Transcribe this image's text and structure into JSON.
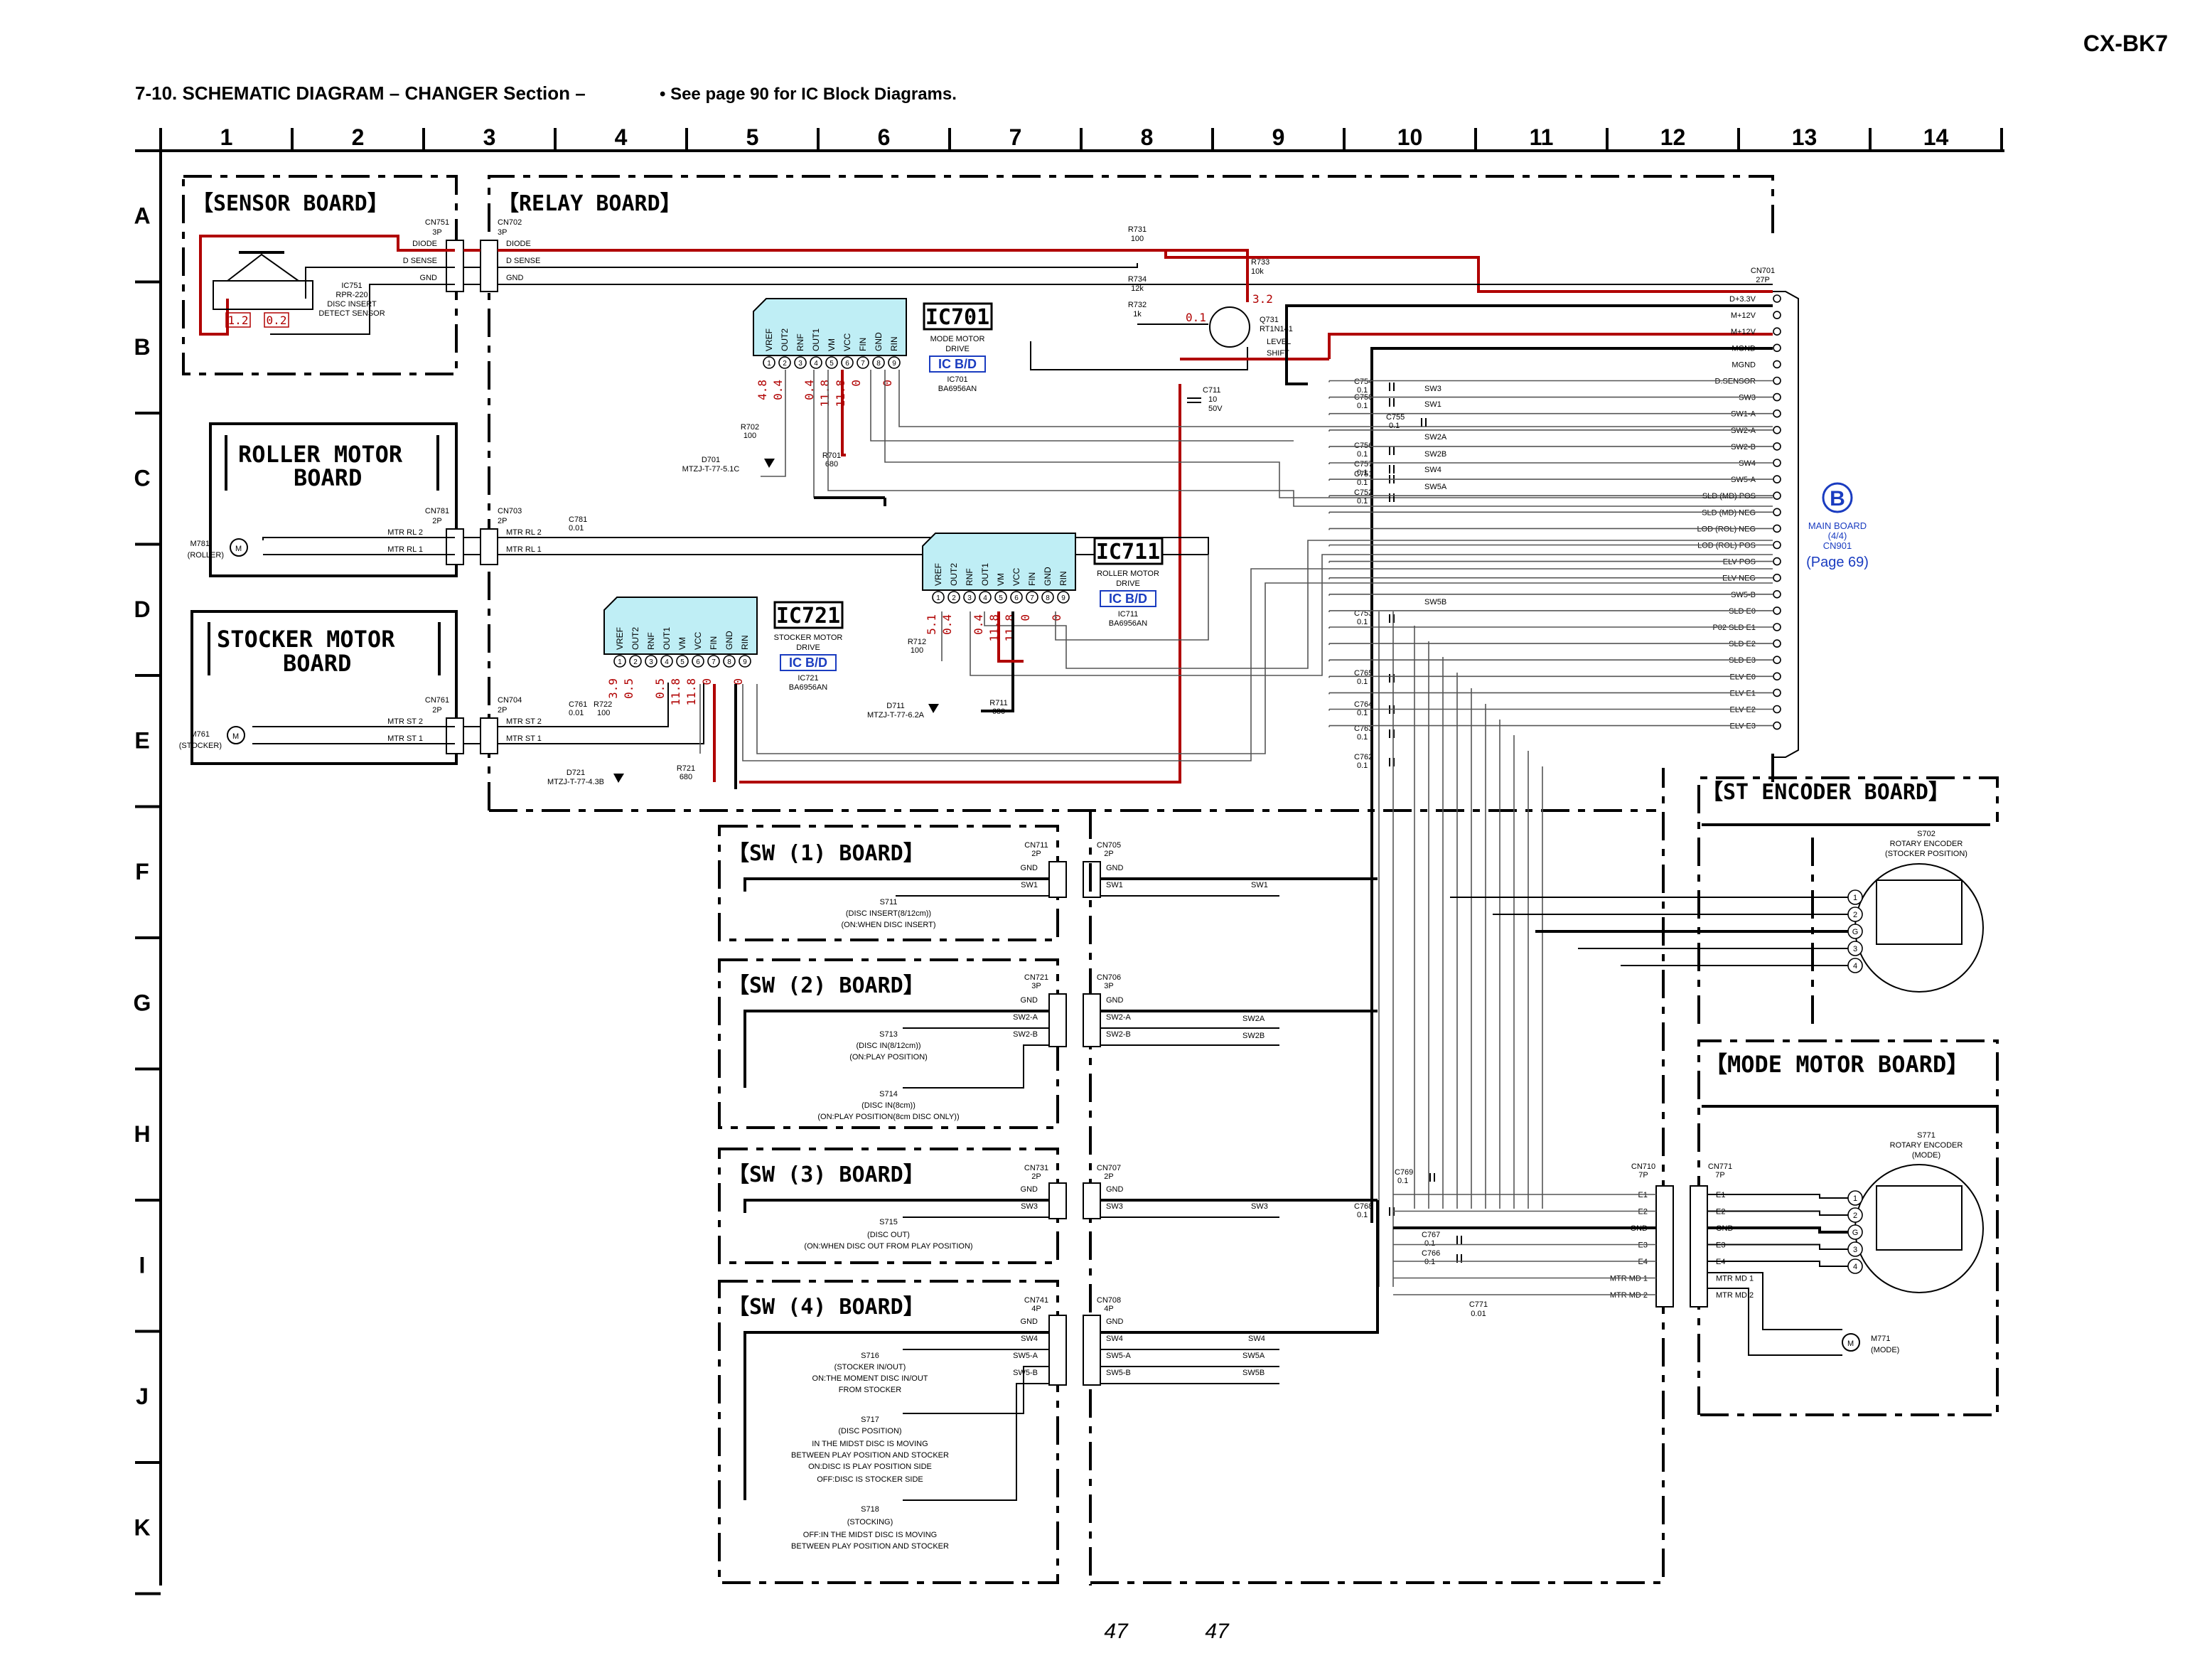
{
  "model": "CX-BK7",
  "title": "7-10.  SCHEMATIC  DIAGRAM  – CHANGER Section –",
  "note": "• See page 90 for IC Block Diagrams.",
  "page_numbers": [
    "47",
    "47"
  ],
  "columns": [
    "1",
    "2",
    "3",
    "4",
    "5",
    "6",
    "7",
    "8",
    "9",
    "10",
    "11",
    "12",
    "13",
    "14"
  ],
  "rows": [
    "A",
    "B",
    "C",
    "D",
    "E",
    "F",
    "G",
    "H",
    "I",
    "J",
    "K"
  ],
  "boards": {
    "sensor": "【SENSOR BOARD】",
    "relay": "【RELAY BOARD】",
    "roller_motor_1": "ROLLER MOTOR",
    "roller_motor_2": "BOARD",
    "stocker_motor_1": "STOCKER MOTOR",
    "stocker_motor_2": "BOARD",
    "sw1": "【SW (1) BOARD】",
    "sw2": "【SW (2) BOARD】",
    "sw3": "【SW (3) BOARD】",
    "sw4": "【SW (4) BOARD】",
    "st_encoder": "【ST ENCODER BOARD】",
    "mode_motor": "【MODE MOTOR BOARD】"
  },
  "sensor": {
    "cn751": [
      "CN751",
      "3P"
    ],
    "pins": [
      "DIODE",
      "D SENSE",
      "GND"
    ],
    "ic751": [
      "IC751",
      "RPR-220",
      "DISC INSERT",
      "DETECT SENSOR"
    ],
    "v1": "1.2",
    "v2": "0.2"
  },
  "relay": {
    "cn702": [
      "CN702",
      "3P"
    ],
    "cn702_pins": [
      "DIODE",
      "D SENSE",
      "GND"
    ],
    "r731": [
      "R731",
      "100"
    ],
    "r733": [
      "R733",
      "10k"
    ],
    "r734": [
      "R734",
      "12k"
    ],
    "r732": [
      "R732",
      "1k"
    ],
    "q731": [
      "Q731",
      "RT1N141",
      "LEVEL",
      "SHIFT"
    ],
    "q_v1": "0.1",
    "q_v2": "3.2",
    "c711": [
      "C711",
      "10",
      "50V"
    ],
    "cn781": [
      "CN781",
      "2P"
    ],
    "cn703": [
      "CN703",
      "2P"
    ],
    "c781": [
      "C781",
      "0.01"
    ],
    "roller_pins": [
      "MTR RL 2",
      "MTR RL 1"
    ],
    "m781": [
      "M781",
      "(ROLLER)"
    ],
    "cn761": [
      "CN761",
      "2P"
    ],
    "cn704": [
      "CN704",
      "2P"
    ],
    "c761": [
      "C761",
      "0.01"
    ],
    "r722": [
      "R722",
      "100"
    ],
    "stocker_pins": [
      "MTR ST 2",
      "MTR ST 1"
    ],
    "m761": [
      "M761",
      "(STOCKER)"
    ],
    "r702": [
      "R702",
      "100"
    ],
    "d701": [
      "D701",
      "MTZJ-T-77-5.1C"
    ],
    "r701": [
      "R701",
      "680"
    ],
    "r712": [
      "R712",
      "100"
    ],
    "d711": [
      "D711",
      "MTZJ-T-77-6.2A"
    ],
    "r711": [
      "R711",
      "680"
    ],
    "r721": [
      "R721",
      "680"
    ],
    "d721": [
      "D721",
      "MTZJ-T-77-4.3B"
    ]
  },
  "ics": [
    {
      "key": "ic701",
      "name": "IC701",
      "desc": [
        "MODE MOTOR",
        "DRIVE"
      ],
      "bd": "IC B/D",
      "part": [
        "IC701",
        "BA6956AN"
      ],
      "pins": [
        "VREF",
        "OUT2",
        "RNF",
        "OUT1",
        "VM",
        "VCC",
        "FIN",
        "GND",
        "RIN"
      ],
      "volts": [
        "4.8",
        "0.4",
        "",
        "0.4",
        "11.8",
        "11.8",
        "0",
        "",
        "0"
      ]
    },
    {
      "key": "ic711",
      "name": "IC711",
      "desc": [
        "ROLLER MOTOR",
        "DRIVE"
      ],
      "bd": "IC B/D",
      "part": [
        "IC711",
        "BA6956AN"
      ],
      "pins": [
        "VREF",
        "OUT2",
        "RNF",
        "OUT1",
        "VM",
        "VCC",
        "FIN",
        "GND",
        "RIN"
      ],
      "volts": [
        "5.1",
        "0.4",
        "",
        "0.4",
        "11.8",
        "11.8",
        "0",
        "",
        "0"
      ]
    },
    {
      "key": "ic721",
      "name": "IC721",
      "desc": [
        "STOCKER MOTOR",
        "DRIVE"
      ],
      "bd": "IC B/D",
      "part": [
        "IC721",
        "BA6956AN"
      ],
      "pins": [
        "VREF",
        "OUT2",
        "RNF",
        "OUT1",
        "VM",
        "VCC",
        "FIN",
        "GND",
        "RIN"
      ],
      "volts": [
        "3.9",
        "0.5",
        "",
        "0.5",
        "11.8",
        "11.8",
        "0",
        "",
        "0"
      ]
    }
  ],
  "caps": [
    [
      "C754",
      "0.1"
    ],
    [
      "C758",
      "0.1"
    ],
    [
      "C755",
      "0.1"
    ],
    [
      "C756",
      "0.1"
    ],
    [
      "C757",
      "0.1"
    ],
    [
      "C751",
      "0.1"
    ],
    [
      "C752",
      "0.1"
    ],
    [
      "C753",
      "0.1"
    ],
    [
      "C765",
      "0.1"
    ],
    [
      "C764",
      "0.1"
    ],
    [
      "C763",
      "0.1"
    ],
    [
      "C762",
      "0.1"
    ],
    [
      "C769",
      "0.1"
    ],
    [
      "C768",
      "0.1"
    ],
    [
      "C767",
      "0.1"
    ],
    [
      "C766",
      "0.1"
    ],
    [
      "C771",
      "0.01"
    ]
  ],
  "sw_labels": [
    "SW3",
    "SW1",
    "SW2A",
    "SW2B",
    "SW4",
    "SW5A",
    "SW5B"
  ],
  "cn701": {
    "label": [
      "CN701",
      "27P"
    ],
    "pins": [
      "D+3.3V",
      "M+12V",
      "M+12V",
      "MGND",
      "MGND",
      "D.SENSOR",
      "SW3",
      "SW1-A",
      "SW2-A",
      "SW2-B",
      "SW4",
      "SW5-A",
      "SLD (MD) POS",
      "SLD (MD) NEG",
      "LOD (ROL) NEG",
      "LOD (ROL) POS",
      "ELV POS",
      "ELV NEG",
      "SW5-B",
      "SLD E0",
      "P02 SLD E1",
      "SLD E2",
      "SLD E3",
      "ELV E0",
      "ELV E1",
      "ELV E2",
      "ELV E3"
    ]
  },
  "main_ref": {
    "letter": "B",
    "lines": [
      "MAIN BOARD",
      "(4/4)",
      "CN901"
    ],
    "page": "(Page 69)"
  },
  "sw1": {
    "cn_a": [
      "CN711",
      "2P"
    ],
    "cn_b": [
      "CN705",
      "2P"
    ],
    "pins": [
      "GND",
      "SW1"
    ],
    "net": "SW1",
    "sw": "S711",
    "desc": [
      "(DISC INSERT(8/12cm))",
      "(ON:WHEN DISC INSERT)"
    ]
  },
  "sw2": {
    "cn_a": [
      "CN721",
      "3P"
    ],
    "cn_b": [
      "CN706",
      "3P"
    ],
    "pins": [
      "GND",
      "SW2-A",
      "SW2-B"
    ],
    "nets": [
      "SW2A",
      "SW2B"
    ],
    "s713": "S713",
    "d713": [
      "(DISC IN(8/12cm))",
      "(ON:PLAY POSITION)"
    ],
    "s714": "S714",
    "d714": [
      "(DISC IN(8cm))",
      "(ON:PLAY POSITION(8cm DISC ONLY))"
    ]
  },
  "sw3": {
    "cn_a": [
      "CN731",
      "2P"
    ],
    "cn_b": [
      "CN707",
      "2P"
    ],
    "pins": [
      "GND",
      "SW3"
    ],
    "net": "SW3",
    "sw": "S715",
    "desc": [
      "(DISC OUT)",
      "(ON:WHEN DISC OUT FROM PLAY POSITION)"
    ]
  },
  "sw4": {
    "cn_a": [
      "CN741",
      "4P"
    ],
    "cn_b": [
      "CN708",
      "4P"
    ],
    "pins": [
      "GND",
      "SW4",
      "SW5-A",
      "SW5-B"
    ],
    "nets": [
      "SW4",
      "SW5A",
      "SW5B"
    ],
    "s716": "S716",
    "d716": [
      "(STOCKER IN/OUT)",
      "ON:THE MOMENT DISC IN/OUT",
      "FROM STOCKER"
    ],
    "s717": "S717",
    "d717": [
      "(DISC POSITION)",
      "IN THE MIDST DISC IS MOVING",
      "BETWEEN PLAY POSITION AND STOCKER",
      "ON:DISC IS PLAY POSITION SIDE",
      "OFF:DISC IS STOCKER SIDE"
    ],
    "s718": "S718",
    "d718": [
      "(STOCKING)",
      "OFF:IN THE MIDST DISC IS MOVING",
      "BETWEEN PLAY POSITION AND STOCKER"
    ]
  },
  "st_encoder": {
    "sw": [
      "S702",
      "ROTARY ENCODER",
      "(STOCKER POSITION)"
    ],
    "pins": [
      "1",
      "2",
      "G",
      "3",
      "4"
    ]
  },
  "mode": {
    "cn710": [
      "CN710",
      "7P"
    ],
    "cn771": [
      "CN771",
      "7P"
    ],
    "pins": [
      "E1",
      "E2",
      "GND",
      "E3",
      "E4",
      "MTR MD 1",
      "MTR MD 2"
    ],
    "sw": [
      "S771",
      "ROTARY ENCODER",
      "(MODE)"
    ],
    "enc_pins": [
      "1",
      "2",
      "G",
      "3",
      "4"
    ],
    "m771": [
      "M771",
      "(MODE)"
    ]
  },
  "colors": {
    "red": "#b00000",
    "ic_fill": "#bfeef5",
    "blue": "#1a3cc0",
    "text": "#000000"
  }
}
